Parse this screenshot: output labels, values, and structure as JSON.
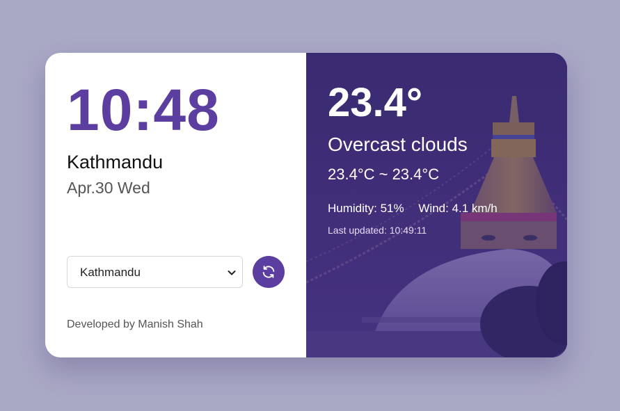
{
  "clock": {
    "time": "10:48",
    "city": "Kathmandu",
    "date": "Apr.30 Wed"
  },
  "location_select": {
    "selected": "Kathmandu"
  },
  "refresh_button": {
    "icon": "refresh-icon"
  },
  "footer": {
    "credit": "Developed by Manish Shah"
  },
  "weather": {
    "temperature": "23.4°",
    "description": "Overcast clouds",
    "range": "23.4°C ~ 23.4°C",
    "humidity": "Humidity: 51%",
    "wind": "Wind: 4.1 km/h",
    "last_updated": "Last updated: 10:49:11"
  },
  "colors": {
    "accent": "#5b3ea0",
    "page_background": "#a9a8c5",
    "weather_panel": "#3f2d78"
  }
}
